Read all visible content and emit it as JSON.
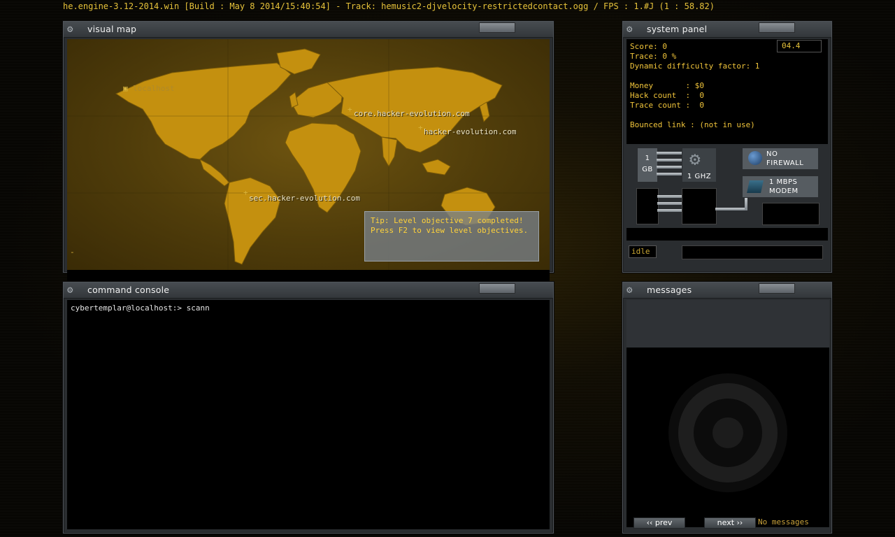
{
  "topbar": {
    "text": "he.engine-3.12-2014.win [Build : May  8 2014/15:40:54] - Track: hemusic2-djvelocity-restrictedcontact.ogg / FPS : 1.#J (1 : 58.82)"
  },
  "visual_map": {
    "title": "visual map",
    "nodes": [
      {
        "label": "localhost"
      },
      {
        "label": "core.hacker-evolution.com"
      },
      {
        "label": "hacker-evolution.com"
      },
      {
        "label": "sec.hacker-evolution.com"
      }
    ],
    "tip_line1": "Tip: Level objective 7 completed!",
    "tip_line2": "Press F2 to view level objectives.",
    "status_marker": "-"
  },
  "system_panel": {
    "title": "system panel",
    "timer": "04.4",
    "score": "Score: 0",
    "trace": "Trace: 0 %",
    "difficulty": "Dynamic difficulty factor: 1",
    "money": "Money       : $0",
    "hack_count": "Hack count  :  0",
    "trace_count": "Trace count :  0",
    "bounced": "Bounced link : (not in use)",
    "memory_line1": "1",
    "memory_line2": "GB",
    "cpu": "1 GHZ",
    "firewall_line1": "NO",
    "firewall_line2": "FIREWALL",
    "modem_line1": "1 MBPS",
    "modem_line2": "MODEM",
    "status": "idle"
  },
  "command_console": {
    "title": "command console",
    "prompt": "cybertemplar@localhost:> ",
    "input": "scann"
  },
  "messages": {
    "title": "messages",
    "prev_label": "‹‹ prev",
    "next_label": "next ››",
    "empty_label": "No messages"
  },
  "colors": {
    "accent": "#e6c23a",
    "panel": "#2a2d30",
    "map": "#6e5410"
  }
}
